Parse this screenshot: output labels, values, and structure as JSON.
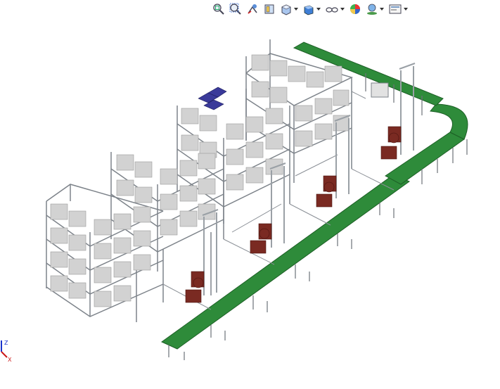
{
  "toolbar": {
    "tools": [
      {
        "name": "zoom-to-fit-icon"
      },
      {
        "name": "zoom-to-area-icon"
      },
      {
        "name": "previous-view-icon"
      },
      {
        "name": "section-view-icon"
      },
      {
        "name": "view-orientation-icon"
      },
      {
        "name": "display-style-icon"
      },
      {
        "name": "hide-show-items-icon"
      },
      {
        "name": "edit-appearance-icon"
      },
      {
        "name": "apply-scene-icon"
      },
      {
        "name": "view-settings-icon"
      }
    ]
  },
  "triad": {
    "y_label": "Z",
    "x_label": "X",
    "y_color": "#1a33cc",
    "x_color": "#cc1a1a"
  },
  "colors": {
    "frame": "#8a8f96",
    "box": "#d2d2d2",
    "conveyor": "#2e8b3a",
    "robot": "#7a2a22",
    "part": "#3a3a9a"
  }
}
